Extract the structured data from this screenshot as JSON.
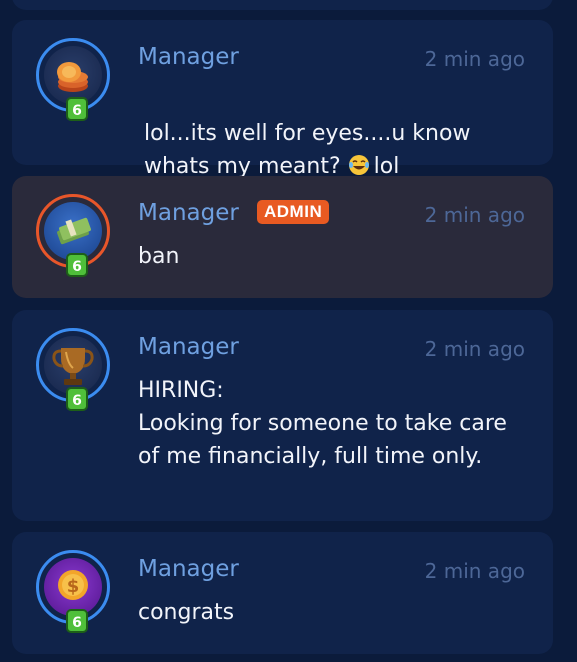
{
  "messages": [
    {
      "username": "Manager",
      "timestamp": "2 min ago",
      "level": "6",
      "text_before": "lol...its well for eyes....u know whats my meant? ",
      "emoji": "tears-of-joy-emoji-icon",
      "text_after": "lol",
      "avatar_icon": "coin-stack-icon"
    },
    {
      "username": "Manager",
      "badge": "ADMIN",
      "timestamp": "2 min ago",
      "level": "6",
      "text": "ban",
      "avatar_icon": "cash-bundle-icon"
    },
    {
      "username": "Manager",
      "timestamp": "2 min ago",
      "level": "6",
      "text": "HIRING:\nLooking for someone to take care of me financially, full time only.",
      "avatar_icon": "trophy-icon"
    },
    {
      "username": "Manager",
      "timestamp": "2 min ago",
      "level": "6",
      "text": "congrats",
      "avatar_icon": "dollar-coin-icon"
    }
  ],
  "colors": {
    "background": "#0b1b3b",
    "card": "#10234a",
    "admin_card": "#2a2a3b",
    "username": "#6fa0e0",
    "timestamp": "#4d6797",
    "admin_badge": "#e85a22",
    "level_badge": "#4fbf3a"
  }
}
